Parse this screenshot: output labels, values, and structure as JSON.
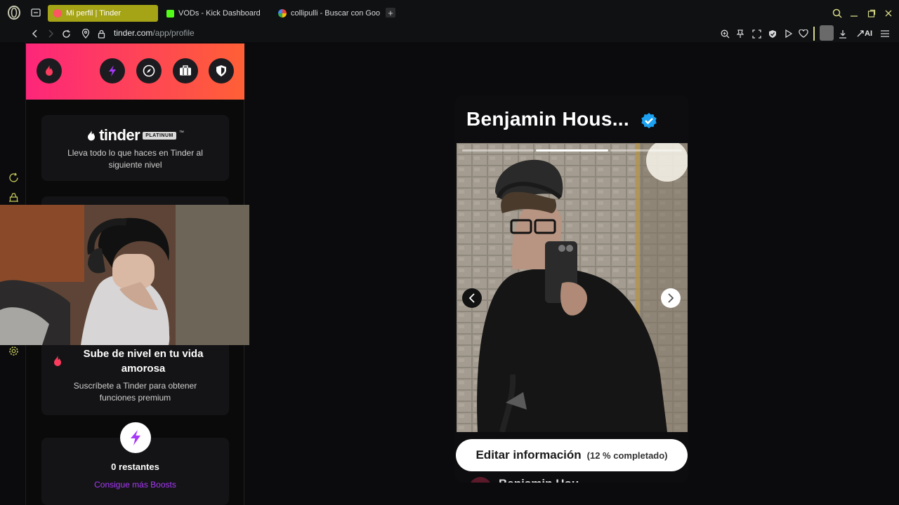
{
  "browser": {
    "tabs": [
      {
        "label": "Mi perfil | Tinder",
        "active": true,
        "favicon_color": "#fd5564"
      },
      {
        "label": "VODs - Kick Dashboard",
        "active": false,
        "favicon_color": "#53fc18"
      },
      {
        "label": "collipulli - Buscar con Goo",
        "active": false,
        "favicon_color": "#4285f4"
      }
    ],
    "url_host": "tinder.com",
    "url_path": "/app/profile",
    "ai_label": "AI"
  },
  "sidebar": {
    "platinum": {
      "brand": "tinder",
      "badge": "PLATINUM",
      "tm": "™",
      "text": "Lleva todo lo que haces en Tinder al siguiente nivel"
    },
    "premium": {
      "title": "Sube de nivel en tu vida amorosa",
      "text": "Suscríbete a Tinder para obtener funciones premium"
    },
    "boosts": {
      "count": "0 restantes",
      "link": "Consigue más Boosts"
    }
  },
  "profile": {
    "name": "Benjamin Hous...",
    "verified": true,
    "photo_count": 3,
    "current_photo": 2,
    "edit_label": "Editar información",
    "completion": "(12 % completado)",
    "next_section_partial": "Benjamin Hou"
  },
  "colors": {
    "tinder_gradient_start": "#fd267a",
    "tinder_gradient_end": "#ff6036",
    "boost_purple": "#a838f9",
    "verified_blue": "#1da1f2"
  }
}
